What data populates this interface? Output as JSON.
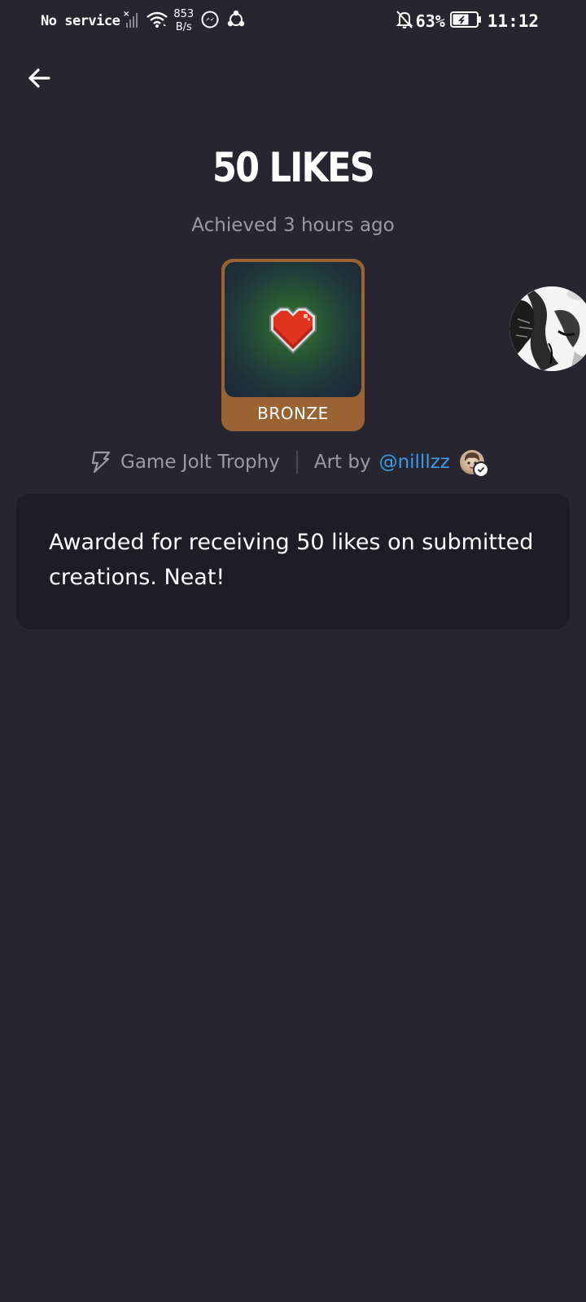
{
  "status_bar": {
    "carrier": "No service",
    "speed_value": "853",
    "speed_unit": "B/s",
    "battery_percent": "63%",
    "time": "11:12",
    "icons": [
      "signal-icon",
      "wifi-icon",
      "messenger-icon",
      "share-icon",
      "bell-off-icon",
      "battery-icon"
    ]
  },
  "header": {
    "back_icon": "arrow-left-icon"
  },
  "trophy": {
    "title": "50 LIKES",
    "achieved": "Achieved 3 hours ago",
    "tier": "BRONZE",
    "tier_color": "#9a6333",
    "image_icon": "heart-icon"
  },
  "credits": {
    "source_label": "Game Jolt Trophy",
    "art_by_label": "Art by",
    "artist_handle": "@nilllzz",
    "link_color": "#3d9be9"
  },
  "description": {
    "text": "Awarded for receiving 50 likes on submitted creations. Neat!"
  },
  "colors": {
    "background": "#27252f",
    "card": "#1e1c25",
    "muted_text": "#9c9aa6"
  }
}
